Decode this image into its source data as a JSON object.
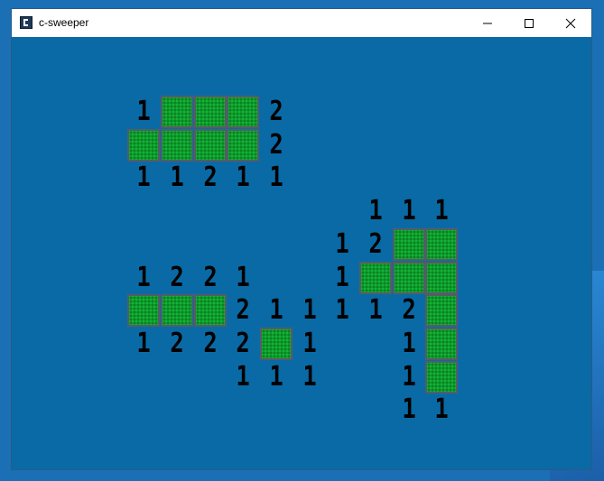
{
  "window": {
    "title": "c-sweeper",
    "icons": {
      "app": "app-icon",
      "minimize": "minimize-icon",
      "maximize": "maximize-icon",
      "close": "close-icon"
    }
  },
  "colors": {
    "board": "#0a6aa6",
    "tile": "#0f9a2c",
    "tile_border": "#555c66",
    "number": "#000000"
  },
  "board": {
    "tiles": [
      {
        "row": 0,
        "col": 5
      },
      {
        "row": 0,
        "col": 6
      },
      {
        "row": 0,
        "col": 7
      },
      {
        "row": 1,
        "col": 4
      },
      {
        "row": 1,
        "col": 5
      },
      {
        "row": 1,
        "col": 6
      },
      {
        "row": 1,
        "col": 7
      },
      {
        "row": 4,
        "col": 12
      },
      {
        "row": 4,
        "col": 13
      },
      {
        "row": 5,
        "col": 11
      },
      {
        "row": 5,
        "col": 12
      },
      {
        "row": 5,
        "col": 13
      },
      {
        "row": 6,
        "col": 4
      },
      {
        "row": 6,
        "col": 5
      },
      {
        "row": 6,
        "col": 6
      },
      {
        "row": 6,
        "col": 13
      },
      {
        "row": 7,
        "col": 8
      },
      {
        "row": 7,
        "col": 13
      },
      {
        "row": 8,
        "col": 13
      }
    ],
    "numbers": [
      {
        "row": 0,
        "col": 4,
        "value": "1"
      },
      {
        "row": 0,
        "col": 8,
        "value": "2"
      },
      {
        "row": 1,
        "col": 8,
        "value": "2"
      },
      {
        "row": 2,
        "col": 4,
        "value": "1"
      },
      {
        "row": 2,
        "col": 5,
        "value": "1"
      },
      {
        "row": 2,
        "col": 6,
        "value": "2"
      },
      {
        "row": 2,
        "col": 7,
        "value": "1"
      },
      {
        "row": 2,
        "col": 8,
        "value": "1"
      },
      {
        "row": 3,
        "col": 11,
        "value": "1"
      },
      {
        "row": 3,
        "col": 12,
        "value": "1"
      },
      {
        "row": 3,
        "col": 13,
        "value": "1"
      },
      {
        "row": 4,
        "col": 10,
        "value": "1"
      },
      {
        "row": 4,
        "col": 11,
        "value": "2"
      },
      {
        "row": 5,
        "col": 4,
        "value": "1"
      },
      {
        "row": 5,
        "col": 5,
        "value": "2"
      },
      {
        "row": 5,
        "col": 6,
        "value": "2"
      },
      {
        "row": 5,
        "col": 7,
        "value": "1"
      },
      {
        "row": 5,
        "col": 10,
        "value": "1"
      },
      {
        "row": 6,
        "col": 7,
        "value": "2"
      },
      {
        "row": 6,
        "col": 8,
        "value": "1"
      },
      {
        "row": 6,
        "col": 9,
        "value": "1"
      },
      {
        "row": 6,
        "col": 10,
        "value": "1"
      },
      {
        "row": 6,
        "col": 11,
        "value": "1"
      },
      {
        "row": 6,
        "col": 12,
        "value": "2"
      },
      {
        "row": 7,
        "col": 4,
        "value": "1"
      },
      {
        "row": 7,
        "col": 5,
        "value": "2"
      },
      {
        "row": 7,
        "col": 6,
        "value": "2"
      },
      {
        "row": 7,
        "col": 7,
        "value": "2"
      },
      {
        "row": 7,
        "col": 9,
        "value": "1"
      },
      {
        "row": 7,
        "col": 12,
        "value": "1"
      },
      {
        "row": 8,
        "col": 7,
        "value": "1"
      },
      {
        "row": 8,
        "col": 8,
        "value": "1"
      },
      {
        "row": 8,
        "col": 9,
        "value": "1"
      },
      {
        "row": 8,
        "col": 12,
        "value": "1"
      },
      {
        "row": 9,
        "col": 12,
        "value": "1"
      },
      {
        "row": 9,
        "col": 13,
        "value": "1"
      }
    ]
  }
}
